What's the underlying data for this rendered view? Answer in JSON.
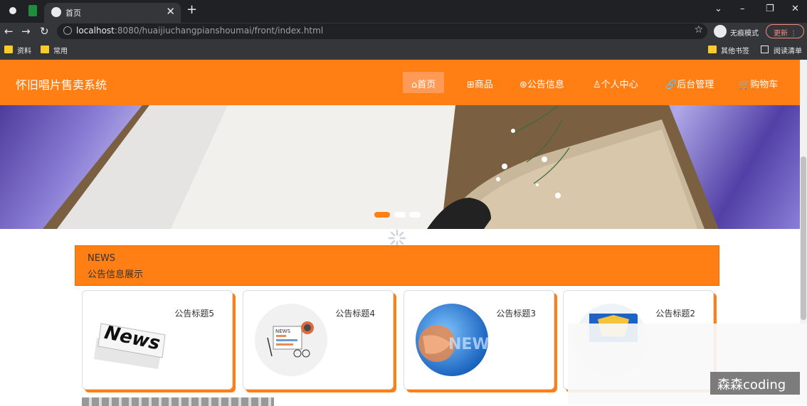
{
  "browser": {
    "tab_title": "首页",
    "url_host": "localhost",
    "url_path": ":8080/huaijiuchangpianshoumai/front/index.html",
    "incognito_label": "无痕模式",
    "update_label": "更新",
    "bookmarks": [
      "资料",
      "常用"
    ],
    "other_bookmarks": "其他书签",
    "reading_list": "阅读清单"
  },
  "site": {
    "brand": "怀旧唱片售卖系统",
    "nav": [
      {
        "icon": "⌂",
        "label": "首页"
      },
      {
        "icon": "⊞",
        "label": "商品"
      },
      {
        "icon": "⊛",
        "label": "公告信息"
      },
      {
        "icon": "♙",
        "label": "个人中心"
      },
      {
        "icon": "🔗",
        "label": "后台管理"
      },
      {
        "icon": "🛒",
        "label": "购物车"
      }
    ],
    "accent": "#ff7f14",
    "carousel_active_index": 0,
    "carousel_count": 3
  },
  "news": {
    "header_en": "NEWS",
    "header_cn": "公告信息展示",
    "cards": [
      {
        "title": "公告标题5",
        "image": "news-newspaper-image"
      },
      {
        "title": "公告标题4",
        "image": "news-illustration-image"
      },
      {
        "title": "公告标题3",
        "image": "news-globe-image"
      },
      {
        "title": "公告标题2",
        "image": "news-badge-image"
      }
    ]
  },
  "watermark": "森森coding"
}
